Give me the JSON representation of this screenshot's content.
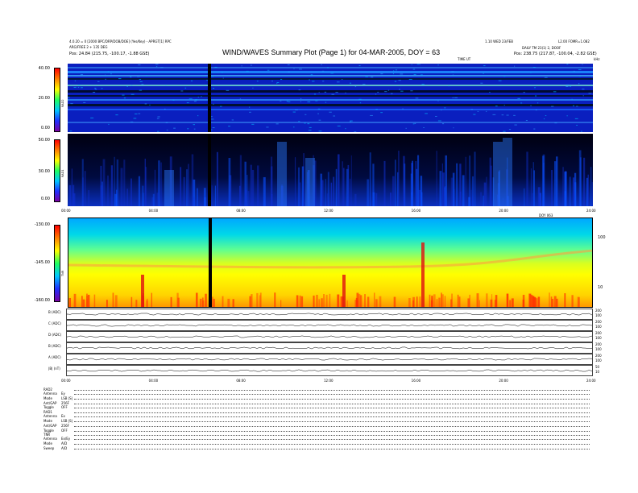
{
  "header": {
    "left_line1": "4.0.20 = 0 [2000 BPC/DRP/DOB/DOE] (Yes/Key) - APRGT[1] RPC",
    "left_line2": "ARG/FREE 2 + 135 DEG",
    "left_pos": "Pos:    24.84 (215.75, -100.17, -1.88 GSE)",
    "title": "WIND/WAVES Summary Plot (Page 1) for 04-MAR-2005, DOY = 63",
    "right_line1": "1.10 WED 23/FEB",
    "right_line1b": "L2.00 FOMR=1.082",
    "right_line2": "DAILY  TM 23(1) 2, DOOF",
    "right_pos": "Pos:    238.75 (217.87, -100.04, -2.82 GSE)",
    "time_label_top": "TIME UT",
    "unit_khz": "kHz"
  },
  "colors": {
    "rad_bg": "#0a1fbf",
    "rad1_bg": "#000a3a",
    "tnr_gradient": [
      "#00b0ff",
      "#00e0d0",
      "#80ff80",
      "#ffff00",
      "#ffd000",
      "#ff4000"
    ],
    "colorbar": [
      "#7a00a0",
      "#2030ff",
      "#00c8ff",
      "#20ff60",
      "#ffff00",
      "#ff8000",
      "#ff0000"
    ]
  },
  "chart_data": [
    {
      "type": "heatmap",
      "name": "RAD2",
      "ylabel": "RAD2",
      "colorbar_ticks": [
        "40.00",
        "20.00",
        "0.00"
      ],
      "colorbar_range": [
        0,
        40
      ]
    },
    {
      "type": "heatmap",
      "name": "RAD1",
      "ylabel": "RAD1",
      "colorbar_ticks": [
        "50.00",
        "30.00",
        "0.00"
      ],
      "colorbar_range": [
        0,
        50
      ],
      "x_ticks": [
        "00:00",
        "04:00",
        "08:00",
        "12:00",
        "16:00",
        "20:00",
        "24:00"
      ],
      "x_unit_label": "DOY 063"
    },
    {
      "type": "heatmap",
      "name": "TNR",
      "ylabel": "TNR",
      "colorbar_ticks": [
        "-130.00",
        "-145.00",
        "-160.00"
      ],
      "colorbar_range": [
        -160,
        -130
      ],
      "right_ticks": [
        "100",
        "10"
      ]
    },
    {
      "type": "line",
      "name": "traces",
      "series": [
        {
          "name": "B (ADC)",
          "right_ticks": [
            "200",
            "100"
          ]
        },
        {
          "name": "C (ADC)",
          "right_ticks": [
            "200",
            "100"
          ]
        },
        {
          "name": "D (ADC)",
          "right_ticks": [
            "200",
            "100"
          ]
        },
        {
          "name": "B (ADC)",
          "right_ticks": [
            "200",
            "100"
          ]
        },
        {
          "name": "A (ADC)",
          "right_ticks": [
            "200",
            "100"
          ]
        },
        {
          "name": "|B| (nT)",
          "right_ticks": [
            "50",
            "10"
          ]
        }
      ],
      "x_ticks": [
        "00:00",
        "04:00",
        "08:00",
        "12:00",
        "16:00",
        "20:00",
        "24:00"
      ]
    }
  ],
  "footer": {
    "blocks": [
      {
        "head": "RAD2",
        "rows": [
          [
            "Antenna",
            "Ey"
          ],
          [
            "Mode",
            "LSB |S|"
          ],
          [
            "Ant/GAP",
            "256F"
          ],
          [
            "Toggle",
            "OFF"
          ]
        ]
      },
      {
        "head": "RAD1",
        "rows": [
          [
            "Antenna",
            "Ex"
          ],
          [
            "Mode",
            "LSB |S|"
          ],
          [
            "Ant/GAP",
            "256F"
          ],
          [
            "Toggle",
            "OFF"
          ]
        ]
      },
      {
        "head": "TNR",
        "rows": [
          [
            "Antenna",
            "Ex/Ey"
          ],
          [
            "Mode",
            "A/D"
          ],
          [
            "Sweep",
            "A/D"
          ]
        ]
      }
    ]
  }
}
